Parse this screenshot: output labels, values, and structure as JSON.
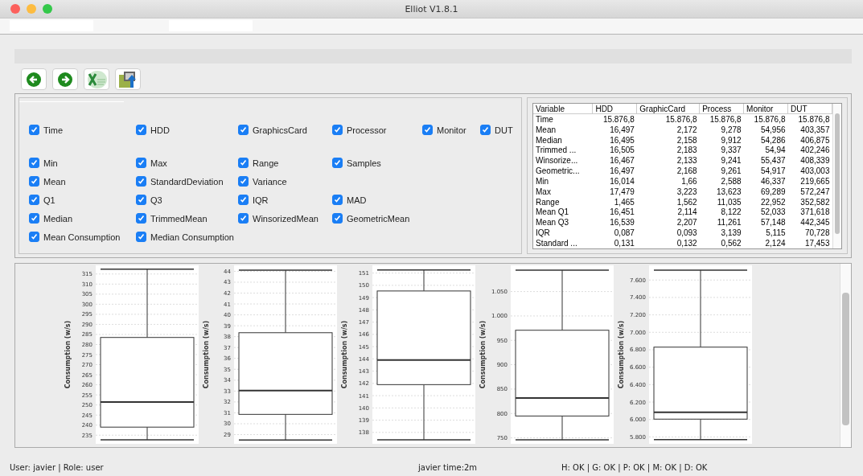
{
  "window": {
    "title": "Elliot V1.8.1"
  },
  "toolbar": [
    {
      "kind": "back"
    },
    {
      "kind": "forward"
    },
    {
      "kind": "spreadsheet"
    },
    {
      "kind": "export"
    }
  ],
  "variables": [
    {
      "label": "Time",
      "checked": true
    },
    {
      "label": "HDD",
      "checked": true
    },
    {
      "label": "GraphicsCard",
      "checked": true
    },
    {
      "label": "Processor",
      "checked": true
    },
    {
      "label": "Monitor",
      "checked": true
    },
    {
      "label": "DUT",
      "checked": true
    }
  ],
  "statistics": [
    [
      {
        "label": "Min",
        "checked": true
      },
      {
        "label": "Max",
        "checked": true
      },
      {
        "label": "Range",
        "checked": true
      },
      {
        "label": "Samples",
        "checked": true
      }
    ],
    [
      {
        "label": "Mean",
        "checked": true
      },
      {
        "label": "StandardDeviation",
        "checked": true
      },
      {
        "label": "Variance",
        "checked": true
      }
    ],
    [
      {
        "label": "Q1",
        "checked": true
      },
      {
        "label": "Q3",
        "checked": true
      },
      {
        "label": "IQR",
        "checked": true
      },
      {
        "label": "MAD",
        "checked": true
      }
    ],
    [
      {
        "label": "Median",
        "checked": true
      },
      {
        "label": "TrimmedMean",
        "checked": true
      },
      {
        "label": "WinsorizedMean",
        "checked": true
      },
      {
        "label": "GeometricMean",
        "checked": true
      }
    ],
    [
      {
        "label": "Mean Consumption",
        "checked": true
      },
      {
        "label": "Median Consumption",
        "checked": true
      }
    ]
  ],
  "table": {
    "columns": [
      "Variable",
      "HDD",
      "GraphicCard",
      "Process",
      "Monitor",
      "DUT"
    ],
    "rows": [
      [
        "Time",
        "15.876,8",
        "15.876,8",
        "15.876,8",
        "15.876,8",
        "15.876,8"
      ],
      [
        "Mean",
        "16,497",
        "2,172",
        "9,278",
        "54,956",
        "403,357"
      ],
      [
        "Median",
        "16,495",
        "2,158",
        "9,912",
        "54,286",
        "406,875"
      ],
      [
        "Trimmed ...",
        "16,505",
        "2,183",
        "9,337",
        "54,94",
        "402,246"
      ],
      [
        "Winsorize...",
        "16,467",
        "2,133",
        "9,241",
        "55,437",
        "408,339"
      ],
      [
        "Geometric...",
        "16,497",
        "2,168",
        "9,261",
        "54,917",
        "403,003"
      ],
      [
        "Min",
        "16,014",
        "1,66",
        "2,588",
        "46,337",
        "219,665"
      ],
      [
        "Max",
        "17,479",
        "3,223",
        "13,623",
        "69,289",
        "572,247"
      ],
      [
        "Range",
        "1,465",
        "1,562",
        "11,035",
        "22,952",
        "352,582"
      ],
      [
        "Mean Q1",
        "16,451",
        "2,114",
        "8,122",
        "52,033",
        "371,618"
      ],
      [
        "Mean Q3",
        "16,539",
        "2,207",
        "11,261",
        "57,148",
        "442,345"
      ],
      [
        "IQR",
        "0,087",
        "0,093",
        "3,139",
        "5,115",
        "70,728"
      ],
      [
        "Standard ...",
        "0,131",
        "0,132",
        "0,562",
        "2,124",
        "17,453"
      ]
    ]
  },
  "charts": [
    {
      "chart_data": {
        "type": "box",
        "ylabel": "Consumption (w/s)",
        "ylim": [
          231.5,
          318.5
        ],
        "yticks": [
          235,
          240,
          245,
          250,
          255,
          260,
          265,
          270,
          275,
          280,
          285,
          290,
          295,
          300,
          305,
          310,
          315
        ],
        "grid": true,
        "boxes": [
          {
            "low": 232.7,
            "q1": 239,
            "median": 251.5,
            "q3": 283.5,
            "high": 317.4
          }
        ]
      }
    },
    {
      "chart_data": {
        "type": "box",
        "ylabel": "Consumption (w/s)",
        "ylim": [
          28.3,
          44.4
        ],
        "yticks": [
          29,
          30,
          31,
          32,
          33,
          34,
          35,
          36,
          37,
          38,
          39,
          40,
          41,
          42,
          43,
          44
        ],
        "grid": true,
        "boxes": [
          {
            "low": 28.5,
            "q1": 30.86,
            "median": 33.05,
            "q3": 38.36,
            "high": 44.1
          }
        ]
      }
    },
    {
      "chart_data": {
        "type": "box",
        "ylabel": "Consumption (w/s)",
        "ylim": [
          137.2,
          151.5
        ],
        "yticks": [
          138,
          139,
          140,
          141,
          142,
          143,
          144,
          145,
          146,
          147,
          148,
          149,
          150,
          151
        ],
        "grid": true,
        "boxes": [
          {
            "low": 137.4,
            "q1": 141.9,
            "median": 143.9,
            "q3": 149.54,
            "high": 151.25
          }
        ]
      }
    },
    {
      "chart_data": {
        "type": "box",
        "ylabel": "Consumption (w/s)",
        "ylim": [
          741,
          1100.5
        ],
        "yticks": [
          {
            "value": 750,
            "label": "750"
          },
          {
            "value": 800,
            "label": "800"
          },
          {
            "value": 850,
            "label": "850"
          },
          {
            "value": 900,
            "label": "900"
          },
          {
            "value": 950,
            "label": "950"
          },
          {
            "value": 1000,
            "label": "1.000"
          },
          {
            "value": 1050,
            "label": "1.050"
          }
        ],
        "grid": true,
        "boxes": [
          {
            "low": 746,
            "q1": 794.8,
            "median": 831.8,
            "q3": 970.7,
            "high": 1094
          }
        ]
      }
    },
    {
      "chart_data": {
        "type": "box",
        "ylabel": "Consumption (w/s)",
        "ylim": [
          5739,
          7750
        ],
        "yticks": [
          {
            "value": 5800,
            "label": "5.800"
          },
          {
            "value": 6000,
            "label": "6.000"
          },
          {
            "value": 6200,
            "label": "6.200"
          },
          {
            "value": 6400,
            "label": "6.400"
          },
          {
            "value": 6600,
            "label": "6.600"
          },
          {
            "value": 6800,
            "label": "6.800"
          },
          {
            "value": 7000,
            "label": "7.000"
          },
          {
            "value": 7200,
            "label": "7.200"
          },
          {
            "value": 7400,
            "label": "7.400"
          },
          {
            "value": 7600,
            "label": "7.600"
          }
        ],
        "grid": true,
        "boxes": [
          {
            "low": 5768,
            "q1": 6004,
            "median": 6083,
            "q3": 6830,
            "high": 7714
          }
        ]
      }
    }
  ],
  "status_bar": {
    "user": "User: javier | Role: user",
    "session": "javier time:2m",
    "devices": "H: OK | G: OK | P: OK | M: OK | D: OK"
  }
}
